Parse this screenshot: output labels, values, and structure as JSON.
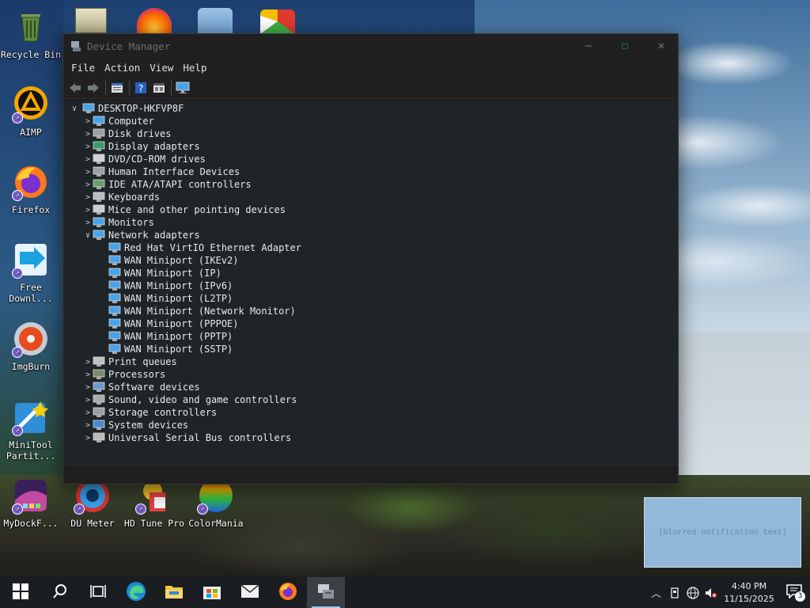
{
  "desktop": {
    "icons": [
      {
        "label": "Recycle Bin",
        "icon": "recycle-bin-icon"
      },
      {
        "label": "AIMP",
        "icon": "aimp-icon"
      },
      {
        "label": "Firefox",
        "icon": "firefox-icon"
      },
      {
        "label": "Free Downl...",
        "icon": "free-download-manager-icon"
      },
      {
        "label": "ImgBurn",
        "icon": "imgburn-icon"
      },
      {
        "label": "MiniTool Partit...",
        "icon": "minitool-partition-icon"
      },
      {
        "label": "MyDockF...",
        "icon": "mydock-icon"
      },
      {
        "label": "DU Meter",
        "icon": "du-meter-icon"
      },
      {
        "label": "HD Tune Pro",
        "icon": "hd-tune-icon"
      },
      {
        "label": "ColorMania",
        "icon": "colormania-icon"
      }
    ]
  },
  "window": {
    "title": "Device Manager",
    "menu": [
      "File",
      "Action",
      "View",
      "Help"
    ],
    "toolbar": [
      "back-arrow-icon",
      "forward-arrow-icon",
      "properties-icon",
      "help-icon",
      "show-hidden-icon",
      "monitor-icon"
    ],
    "root": "DESKTOP-HKFVP8F",
    "categories": [
      {
        "label": "Computer",
        "icon": "computer-icon"
      },
      {
        "label": "Disk drives",
        "icon": "disk-drive-icon"
      },
      {
        "label": "Display adapters",
        "icon": "display-adapter-icon"
      },
      {
        "label": "DVD/CD-ROM drives",
        "icon": "dvd-icon"
      },
      {
        "label": "Human Interface Devices",
        "icon": "hid-icon"
      },
      {
        "label": "IDE ATA/ATAPI controllers",
        "icon": "ide-controller-icon"
      },
      {
        "label": "Keyboards",
        "icon": "keyboard-icon"
      },
      {
        "label": "Mice and other pointing devices",
        "icon": "mouse-icon"
      },
      {
        "label": "Monitors",
        "icon": "monitor-icon"
      },
      {
        "label": "Network adapters",
        "icon": "network-adapter-icon",
        "expanded": true,
        "children": [
          "Red Hat VirtIO Ethernet Adapter",
          "WAN Miniport (IKEv2)",
          "WAN Miniport (IP)",
          "WAN Miniport (IPv6)",
          "WAN Miniport (L2TP)",
          "WAN Miniport (Network Monitor)",
          "WAN Miniport (PPPOE)",
          "WAN Miniport (PPTP)",
          "WAN Miniport (SSTP)"
        ]
      },
      {
        "label": "Print queues",
        "icon": "printer-icon"
      },
      {
        "label": "Processors",
        "icon": "processor-icon"
      },
      {
        "label": "Software devices",
        "icon": "software-device-icon"
      },
      {
        "label": "Sound, video and game controllers",
        "icon": "speaker-icon"
      },
      {
        "label": "Storage controllers",
        "icon": "storage-controller-icon"
      },
      {
        "label": "System devices",
        "icon": "system-device-icon"
      },
      {
        "label": "Universal Serial Bus controllers",
        "icon": "usb-icon"
      }
    ]
  },
  "toast": {
    "text": "[blurred notification text]"
  },
  "taskbar": {
    "apps": [
      "start-icon",
      "search-icon",
      "task-view-icon",
      "edge-icon",
      "file-explorer-icon",
      "store-icon",
      "mail-icon",
      "firefox-icon",
      "device-manager-icon"
    ],
    "clock_time": "4:40 PM",
    "clock_date": "11/15/2025",
    "notification_count": "3"
  },
  "colors": {
    "window_bg": "#1f2428",
    "taskbar_bg": "#1a1d22",
    "accent": "#9fc6ef"
  }
}
